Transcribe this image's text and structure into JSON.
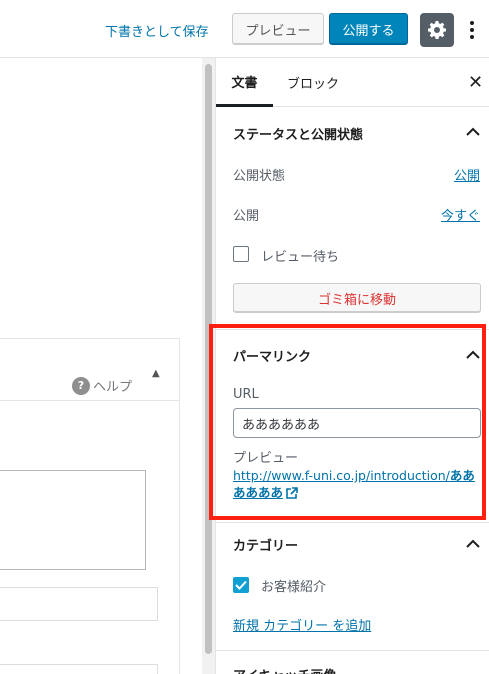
{
  "toolbar": {
    "save_draft_label": "下書きとして保存",
    "preview_label": "プレビュー",
    "publish_label": "公開する"
  },
  "editor": {
    "help_label": "ヘルプ"
  },
  "sidebar": {
    "tabs": [
      {
        "label": "文書",
        "active": true
      },
      {
        "label": "ブロック",
        "active": false
      }
    ],
    "status_panel": {
      "title": "ステータスと公開状態",
      "visibility_label": "公開状態",
      "visibility_value": "公開",
      "publish_label": "公開",
      "publish_value": "今すぐ",
      "pending_review_label": "レビュー待ち",
      "pending_review_checked": false,
      "trash_label": "ゴミ箱に移動"
    },
    "permalink_panel": {
      "title": "パーマリンク",
      "url_label": "URL",
      "url_value": "ああああああ",
      "preview_label": "プレビュー",
      "preview_link_base": "http://www.f-uni.co.jp/introduction/",
      "preview_link_slug": "ああああああ"
    },
    "category_panel": {
      "title": "カテゴリー",
      "items": [
        {
          "label": "お客様紹介",
          "checked": true
        }
      ],
      "add_new_label": "新規 カテゴリー を追加"
    },
    "featured_image_panel": {
      "title": "アイキャッチ画像"
    }
  },
  "colors": {
    "accent": "#0085ba",
    "link": "#0073aa",
    "highlight_box": "#ff1f10",
    "danger": "#dc3232",
    "checkbox_checked": "#11a0d2"
  }
}
